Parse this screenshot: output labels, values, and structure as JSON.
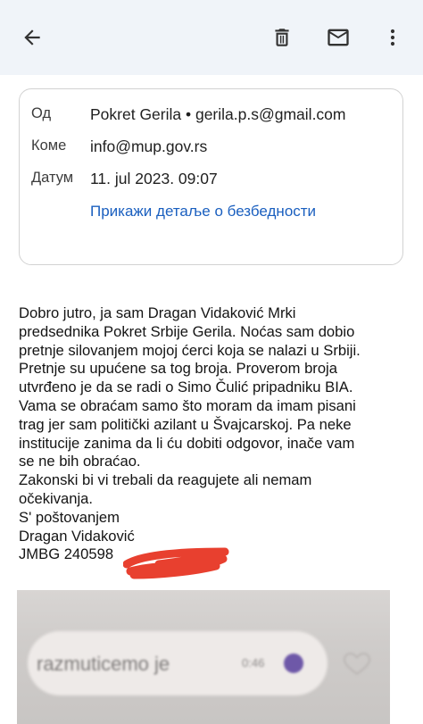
{
  "toolbar": {
    "back_icon": "arrow-back-icon",
    "delete_icon": "trash-icon",
    "mark_unread_icon": "mail-icon",
    "more_icon": "more-vert-icon"
  },
  "header": {
    "from_label": "Од",
    "from_value": "Pokret Gerila • gerila.p.s@gmail.com",
    "to_label": "Коме",
    "to_value": "info@mup.gov.rs",
    "date_label": "Датум",
    "date_value": "11. jul 2023. 09:07",
    "security_link": "Прикажи детаље о безбедности"
  },
  "message": {
    "lines": [
      "Dobro jutro, ja sam Dragan Vidaković Mrki",
      "predsednika Pokret Srbije Gerila. Noćas sam dobio",
      "pretnje silovanjem mojoj ćerci koja se nalazi u Srbiji.",
      "Pretnje su upućene sa tog broja. Proverom broja",
      "utvrđeno je da se radi o Simo Čulić pripadniku BIA.",
      "Vama se obraćam samo što moram da imam pisani",
      "trag jer sam politički azilant u Švajcarskoj. Pa neke",
      "institucije zanima da li ću dobiti odgovor, inače vam",
      "se ne bih obraćao.",
      "Zakonski bi vi trebali  da reagujete ali nemam",
      "očekivanja.",
      "S' poštovanjem",
      "Dragan Vidaković",
      "JMBG 240598"
    ]
  },
  "attachment": {
    "bubble_text": "razmuticemo je",
    "bubble_time": "0:46"
  },
  "colors": {
    "topbar_bg": "#f0f4f9",
    "link": "#1a5fbf",
    "redaction": "#e8402f"
  }
}
